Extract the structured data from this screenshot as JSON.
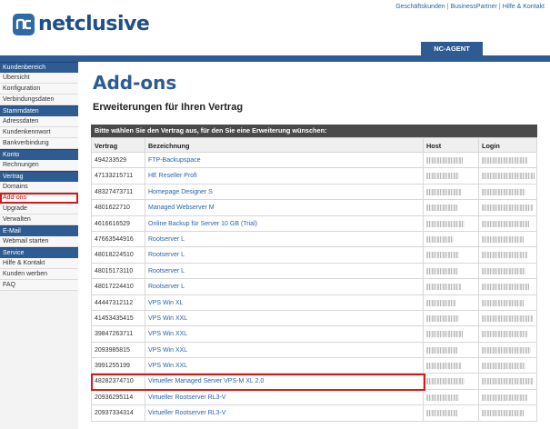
{
  "brand": {
    "name": "netclusive",
    "icon": "nc-logo-icon"
  },
  "top_links": [
    "Geschäftskunden",
    "BusinessPartner",
    "Hilfe & Kontakt"
  ],
  "agent_tab": "NC-AGENT",
  "colors": {
    "brand_blue": "#2d5b92",
    "link_blue": "#2a63a8",
    "highlight_red": "#d31a1a"
  },
  "sidebar": {
    "sections": [
      {
        "title": "Kundenbereich",
        "items": [
          "Übersicht",
          "Konfiguration",
          "Verbindungsdaten"
        ]
      },
      {
        "title": "Stammdaten",
        "items": [
          "Adressdaten",
          "Kundenkennwort",
          "Bankverbindung"
        ]
      },
      {
        "title": "Konto",
        "items": [
          "Rechnungen"
        ]
      },
      {
        "title": "Vertrag",
        "items": [
          "Domains",
          "Add-ons",
          "Upgrade",
          "Verwalten"
        ]
      },
      {
        "title": "E-Mail",
        "items": [
          "Webmail starten"
        ]
      },
      {
        "title": "Service",
        "items": [
          "Hilfe & Kontakt",
          "Kunden werben",
          "FAQ"
        ]
      }
    ],
    "active_item": "Add-ons"
  },
  "main": {
    "title": "Add-ons",
    "subtitle": "Erweiterungen für Ihren Vertrag",
    "table_note": "Bitte wählen Sie den Vertrag aus, für den Sie eine Erweiterung wünschen:",
    "columns": [
      "Vertrag",
      "Bezeichnung",
      "Host",
      "Login"
    ],
    "rows": [
      {
        "vertrag": "494233529",
        "bezeichnung": "FTP-Backupspace"
      },
      {
        "vertrag": "47133215711",
        "bezeichnung": "HE Reseller Profi"
      },
      {
        "vertrag": "48327473711",
        "bezeichnung": "Homepage Designer S"
      },
      {
        "vertrag": "4801622710",
        "bezeichnung": "Managed Webserver M"
      },
      {
        "vertrag": "4616616529",
        "bezeichnung": "Online Backup für Server 10 GB (Trial)"
      },
      {
        "vertrag": "47663544916",
        "bezeichnung": "Rootserver L"
      },
      {
        "vertrag": "48018224510",
        "bezeichnung": "Rootserver L"
      },
      {
        "vertrag": "48015173110",
        "bezeichnung": "Rootserver L"
      },
      {
        "vertrag": "48017224410",
        "bezeichnung": "Rootserver L"
      },
      {
        "vertrag": "44447312112",
        "bezeichnung": "VPS Win XL"
      },
      {
        "vertrag": "41453435415",
        "bezeichnung": "VPS Win XXL"
      },
      {
        "vertrag": "39847263711",
        "bezeichnung": "VPS Win XXL"
      },
      {
        "vertrag": "2093985815",
        "bezeichnung": "VPS Win XXL"
      },
      {
        "vertrag": "3991255199",
        "bezeichnung": "VPS Win XXL"
      },
      {
        "vertrag": "48282374710",
        "bezeichnung": "Virtueller Managed Server VPS-M XL 2.0"
      },
      {
        "vertrag": "20936295114",
        "bezeichnung": "Virtueller Rootserver RL3-V"
      },
      {
        "vertrag": "20937334314",
        "bezeichnung": "Virtueller Rootserver RL3-V"
      }
    ],
    "highlighted_row": 14
  }
}
